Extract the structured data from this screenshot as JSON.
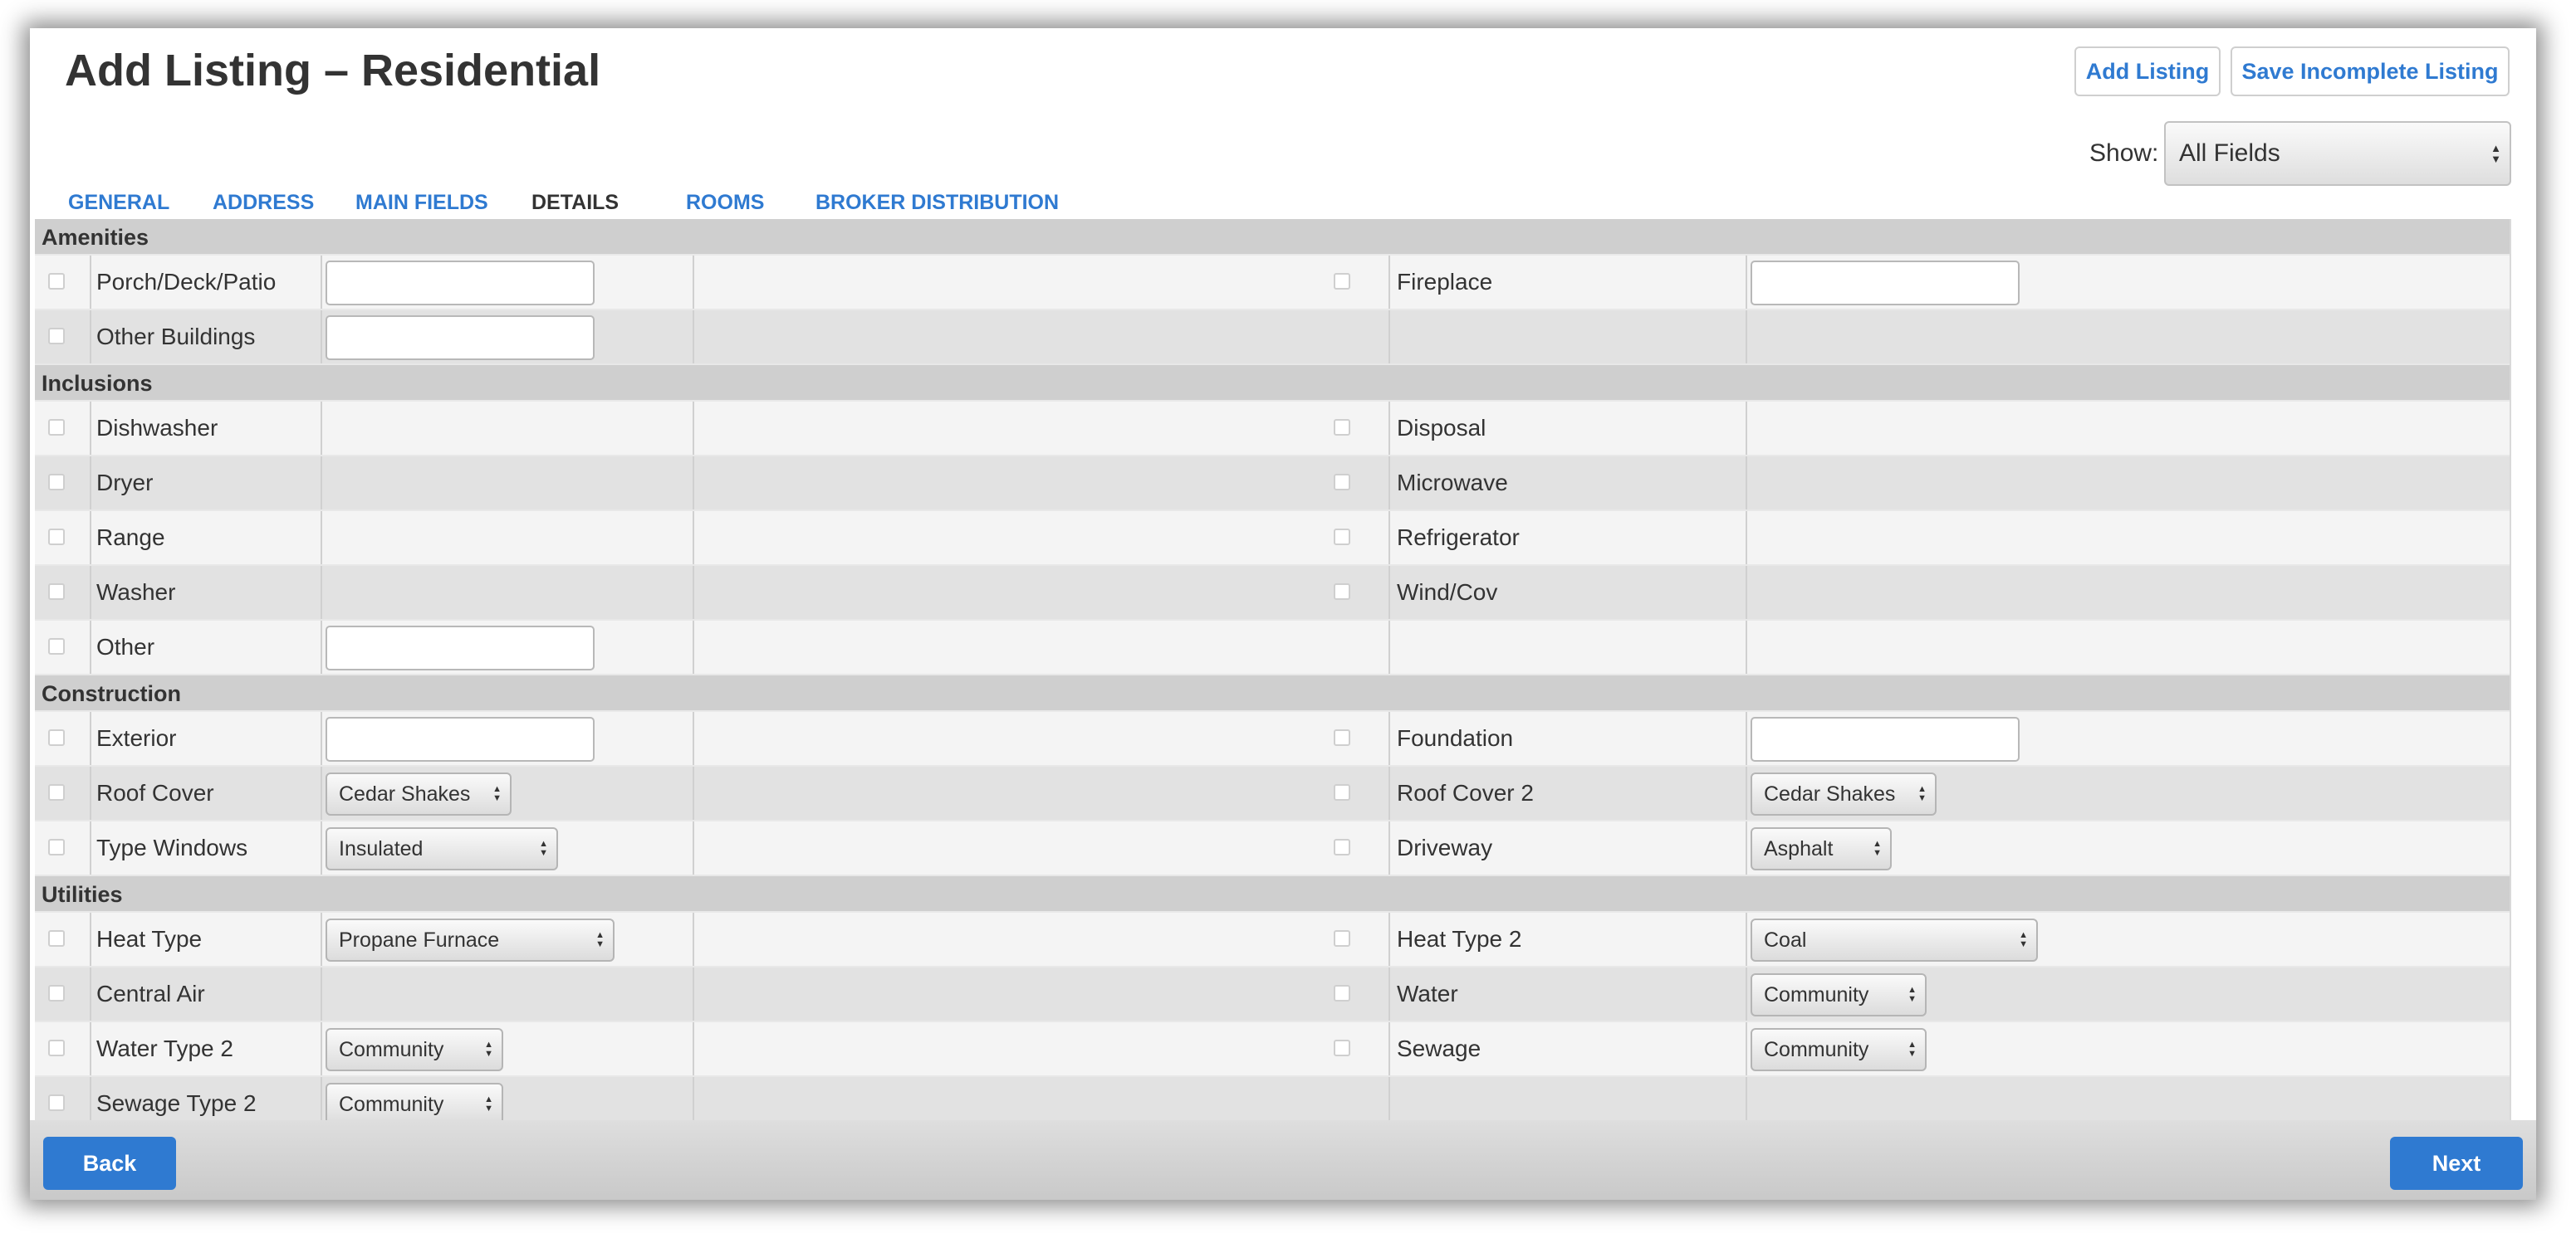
{
  "title": "Add Listing – Residential",
  "buttons": {
    "add_listing": "Add Listing",
    "save_incomplete": "Save Incomplete Listing",
    "back": "Back",
    "next": "Next"
  },
  "show": {
    "label": "Show:",
    "value": "All Fields"
  },
  "tabs": [
    "GENERAL",
    "ADDRESS",
    "MAIN FIELDS",
    "DETAILS",
    "ROOMS",
    "BROKER DISTRIBUTION"
  ],
  "active_tab": "DETAILS",
  "sections": {
    "amenities": {
      "title": "Amenities",
      "rows": [
        {
          "left": {
            "label": "Porch/Deck/Patio",
            "control": "text"
          },
          "right": {
            "label": "Fireplace",
            "control": "text"
          }
        },
        {
          "left": {
            "label": "Other Buildings",
            "control": "text"
          }
        }
      ]
    },
    "inclusions": {
      "title": "Inclusions",
      "rows": [
        {
          "left": {
            "label": "Dishwasher"
          },
          "right": {
            "label": "Disposal"
          }
        },
        {
          "left": {
            "label": "Dryer"
          },
          "right": {
            "label": "Microwave"
          }
        },
        {
          "left": {
            "label": "Range"
          },
          "right": {
            "label": "Refrigerator"
          }
        },
        {
          "left": {
            "label": "Washer"
          },
          "right": {
            "label": "Wind/Cov"
          }
        },
        {
          "left": {
            "label": "Other",
            "control": "text"
          }
        }
      ]
    },
    "construction": {
      "title": "Construction",
      "rows": [
        {
          "left": {
            "label": "Exterior",
            "control": "text"
          },
          "right": {
            "label": "Foundation",
            "control": "text"
          }
        },
        {
          "left": {
            "label": "Roof Cover",
            "control": "select",
            "value": "Cedar Shakes"
          },
          "right": {
            "label": "Roof Cover 2",
            "control": "select",
            "value": "Cedar Shakes"
          }
        },
        {
          "left": {
            "label": "Type Windows",
            "control": "select",
            "value": "Insulated"
          },
          "right": {
            "label": "Driveway",
            "control": "select",
            "value": "Asphalt"
          }
        }
      ]
    },
    "utilities": {
      "title": "Utilities",
      "rows": [
        {
          "left": {
            "label": "Heat Type",
            "control": "select",
            "value": "Propane Furnace"
          },
          "right": {
            "label": "Heat Type 2",
            "control": "select",
            "value": "Coal"
          }
        },
        {
          "left": {
            "label": "Central Air"
          },
          "right": {
            "label": "Water",
            "control": "select",
            "value": "Community"
          }
        },
        {
          "left": {
            "label": "Water Type 2",
            "control": "select",
            "value": "Community"
          },
          "right": {
            "label": "Sewage",
            "control": "select",
            "value": "Community"
          }
        },
        {
          "left": {
            "label": "Sewage Type 2",
            "control": "select",
            "value": "Community"
          }
        }
      ]
    }
  }
}
